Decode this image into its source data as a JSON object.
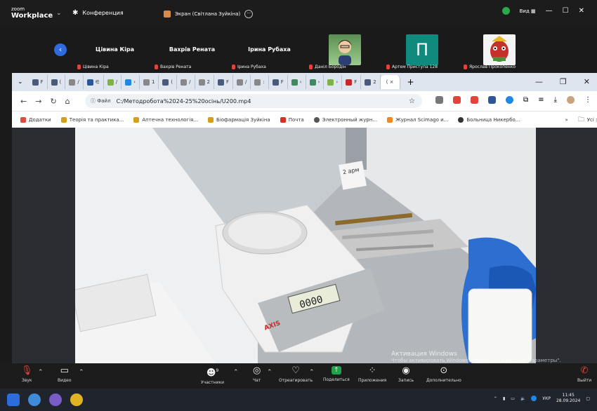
{
  "zoom": {
    "logo_top": "zoom",
    "logo_bottom": "Workplace",
    "conference_label": "Конференция",
    "screen_label": "Экран (Світлана Зуйкіна)",
    "view_label": "Вид",
    "accent": "#2d6cdf"
  },
  "participants": [
    {
      "display": "Цівина Кіра",
      "name": "Цівина Кіра"
    },
    {
      "display": "Вахрів Рената",
      "name": "Вахрів Рената"
    },
    {
      "display": "Ірина Рубаха",
      "name": "Ірина Рубаха"
    },
    {
      "display": "",
      "name": "Даніл Бородін"
    },
    {
      "display": "П",
      "name": "Артем Приступа 128"
    },
    {
      "display": "",
      "name": "Ярослав Прокопенко"
    }
  ],
  "browser": {
    "active_tab": "( ×",
    "new_tab": "+",
    "url_chip": "Файл",
    "url": "C:/Методробота%2024-25%20осінь/U200.mp4",
    "bookmarks": [
      {
        "label": "Додатки",
        "color": "#e04b3c"
      },
      {
        "label": "Теорія та практика...",
        "color": "#d4a017"
      },
      {
        "label": "Аптечна технологія...",
        "color": "#d4a017"
      },
      {
        "label": "Біофармація Зуйкіна",
        "color": "#d4a017"
      },
      {
        "label": "Почта",
        "color": "#d93025"
      },
      {
        "label": "Электронный журн...",
        "color": "#555555"
      },
      {
        "label": "Журнал Scimago и...",
        "color": "#f28b1e"
      },
      {
        "label": "Больница Никербо...",
        "color": "#333333"
      }
    ],
    "more_bookmarks": "»",
    "all_bookmarks": "Усі закладки"
  },
  "video": {
    "tube_label": "2 арм",
    "scale_brand": "AXIS",
    "display_value": "0000"
  },
  "watermark": {
    "title": "Активация Windows",
    "subtitle": "Чтобы активировать Windows, перейдите в раздел \"Параметры\"."
  },
  "toolbar": [
    {
      "label": "Звук",
      "icon": "mic-off"
    },
    {
      "label": "Видео",
      "icon": "video"
    },
    {
      "label": "Участники",
      "icon": "people",
      "count": "9"
    },
    {
      "label": "Чат",
      "icon": "chat"
    },
    {
      "label": "Отреагировать",
      "icon": "heart"
    },
    {
      "label": "Поделиться",
      "icon": "share"
    },
    {
      "label": "Приложения",
      "icon": "apps"
    },
    {
      "label": "Запись",
      "icon": "record"
    },
    {
      "label": "Дополнительно",
      "icon": "more"
    },
    {
      "label": "Выйти",
      "icon": "leave"
    }
  ],
  "taskbar": {
    "lang": "УКР",
    "time": "11:45",
    "date": "28.09.2024"
  }
}
